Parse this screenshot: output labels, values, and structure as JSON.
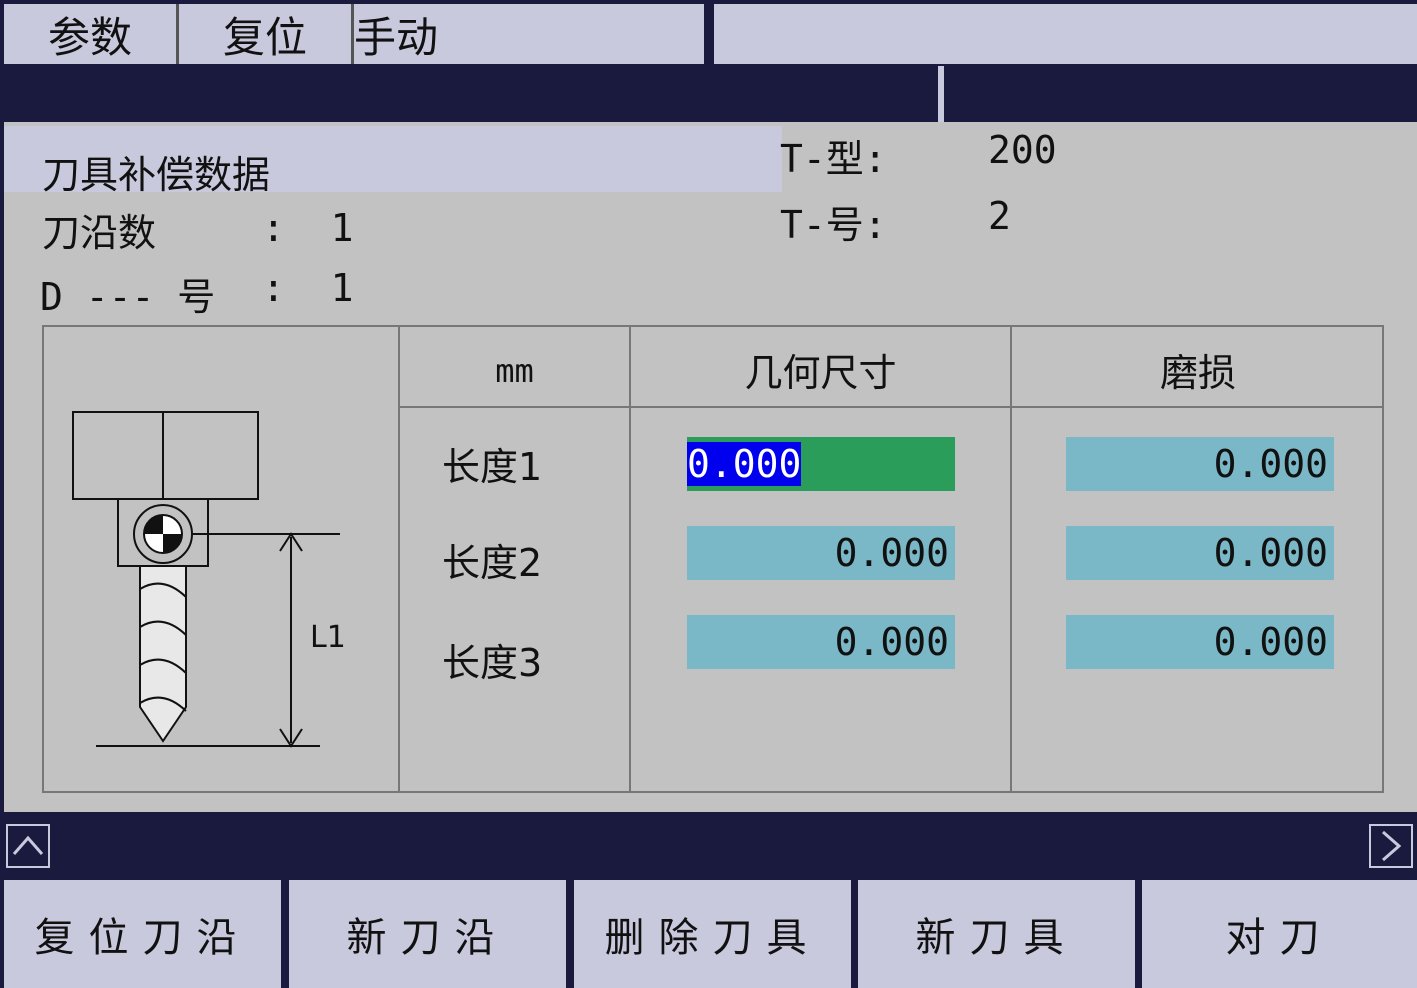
{
  "menu": {
    "tabs": [
      "参数",
      "复位",
      "手动"
    ]
  },
  "panel": {
    "title": "刀具补偿数据",
    "edges_label": "刀沿数",
    "edges_value": ":  1",
    "d_label": "D --- 号",
    "d_value": ":  1",
    "t_type_label": "T-型:",
    "t_type_value": "200",
    "t_no_label": "T-号:",
    "t_no_value": "2"
  },
  "diagram": {
    "dimension_label": "L1"
  },
  "table": {
    "unit_header": "mm",
    "geometry_header": "几何尺寸",
    "wear_header": "磨损",
    "rows": [
      {
        "label": "长度1",
        "geometry": "0.000",
        "wear": "0.000"
      },
      {
        "label": "长度2",
        "geometry": "0.000",
        "wear": "0.000"
      },
      {
        "label": "长度3",
        "geometry": "0.000",
        "wear": "0.000"
      }
    ]
  },
  "nav": {
    "up_icon": "chevron-up-icon",
    "right_icon": "chevron-right-icon"
  },
  "softkeys": [
    "复位刀沿",
    "新刀沿",
    "删除刀具",
    "新刀具",
    "对刀"
  ],
  "colors": {
    "background_dark": "#1a1a3e",
    "panel": "#c2c2c2",
    "menu": "#c9c9dd",
    "field": "#7ab8c8",
    "active_field": "#2a9d5a",
    "selection": "#0000ee"
  }
}
